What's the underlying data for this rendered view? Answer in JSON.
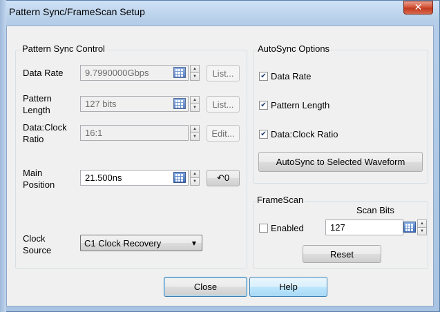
{
  "window": {
    "title": "Pattern Sync/FrameScan Setup"
  },
  "pattern_sync": {
    "title": "Pattern Sync Control",
    "data_rate": {
      "label": "Data Rate",
      "value": "9.7990000Gbps",
      "button": "List..."
    },
    "pattern_length": {
      "label_line1": "Pattern",
      "label_line2": "Length",
      "value": "127 bits",
      "button": "List..."
    },
    "data_clock_ratio": {
      "label_line1": "Data:Clock",
      "label_line2": "Ratio",
      "value": "16:1",
      "button": "Edit..."
    },
    "main_position": {
      "label_line1": "Main",
      "label_line2": "Position",
      "value": "21.500ns",
      "button": "↶0"
    },
    "clock_source": {
      "label_line1": "Clock",
      "label_line2": "Source",
      "selected": "C1 Clock Recovery"
    }
  },
  "autosync": {
    "title": "AutoSync Options",
    "options": [
      {
        "label": "Data Rate",
        "checked": true
      },
      {
        "label": "Pattern Length",
        "checked": true
      },
      {
        "label": "Data:Clock Ratio",
        "checked": true
      }
    ],
    "button": "AutoSync to Selected Waveform"
  },
  "framescan": {
    "title": "FrameScan",
    "scan_bits_label": "Scan Bits",
    "enabled_label": "Enabled",
    "enabled": false,
    "scan_bits_value": "127",
    "reset_button": "Reset"
  },
  "footer": {
    "close_button": "Close",
    "help_button": "Help"
  }
}
